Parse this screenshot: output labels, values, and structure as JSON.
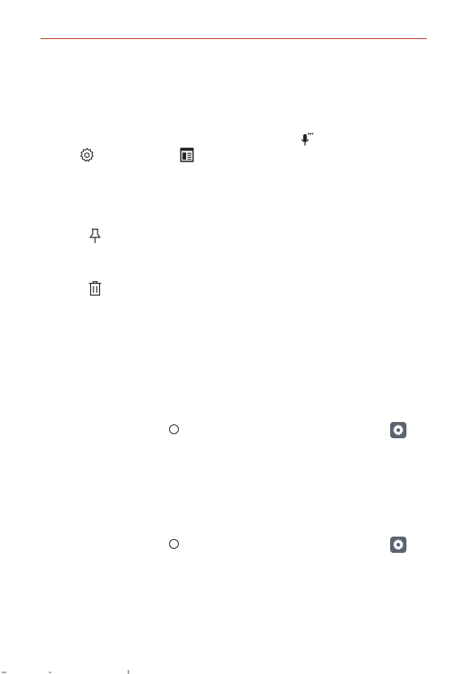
{
  "colors": {
    "header_rule": "#c0392b",
    "icon_stroke": "#222222",
    "settings_tile": "#5b6270"
  },
  "icons": [
    "voice-input-icon",
    "settings-gear-icon",
    "reader-mode-icon",
    "pin-icon",
    "trash-icon",
    "home-button-icon",
    "settings-tile-icon"
  ]
}
